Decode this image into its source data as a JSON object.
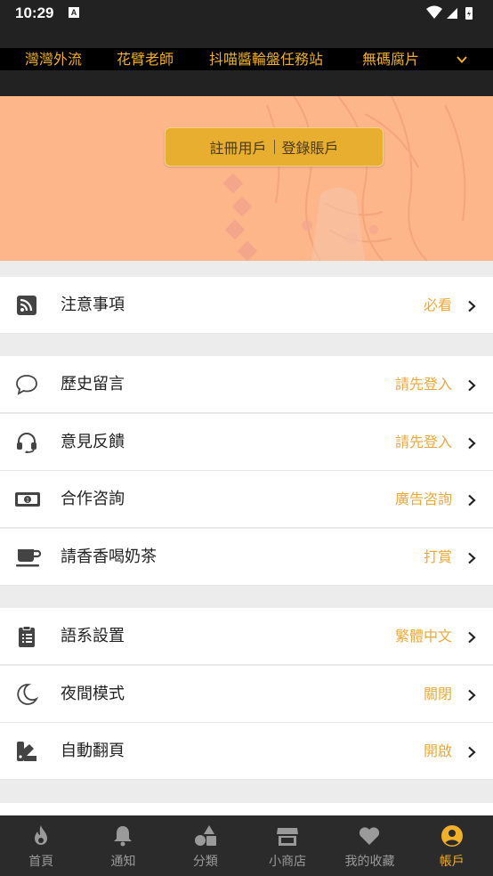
{
  "status_bar": {
    "time": "10:29",
    "notification_letter": "A"
  },
  "categories": {
    "items": [
      "灣灣外流",
      "花臂老師",
      "抖喵醬輪盤任務站",
      "無碼腐片"
    ],
    "expand_icon": "chevron-down-icon"
  },
  "banner": {
    "register_label": "註冊用戶",
    "login_label": "登錄賬戶"
  },
  "menu": {
    "notice": {
      "label": "注意事項",
      "value": "必看",
      "icon": "rss-icon"
    },
    "history": {
      "label": "歷史留言",
      "value": "請先登入",
      "icon": "chat-bubble-icon"
    },
    "feedback": {
      "label": "意見反饋",
      "value": "請先登入",
      "icon": "headset-icon"
    },
    "cooperation": {
      "label": "合作咨詢",
      "value": "廣告咨詢",
      "icon": "money-bill-icon"
    },
    "tea": {
      "label": "請香香喝奶茶",
      "value": "打賞",
      "icon": "coffee-cup-icon"
    },
    "language": {
      "label": "語系設置",
      "value": "繁體中文",
      "icon": "clipboard-list-icon"
    },
    "night": {
      "label": "夜間模式",
      "value": "關閉",
      "icon": "moon-icon"
    },
    "autopage": {
      "label": "自動翻頁",
      "value": "開啟",
      "icon": "swatches-icon"
    }
  },
  "bottom_nav": {
    "home": "首頁",
    "notify": "通知",
    "category": "分類",
    "shop": "小商店",
    "favorites": "我的收藏",
    "account": "帳戶",
    "active": "account"
  },
  "colors": {
    "accent": "#f0b02a",
    "value_text": "#e8a93a",
    "banner_bg": "#fdb58a",
    "nav_bg": "#2b2b2b"
  }
}
